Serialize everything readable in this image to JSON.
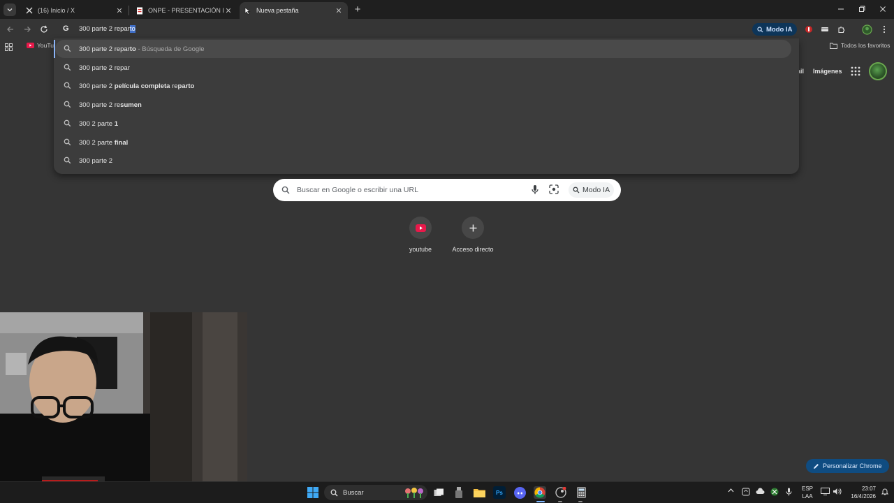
{
  "tabs": [
    {
      "title": "(16) Inicio / X",
      "favicon": "x-logo-icon"
    },
    {
      "title": "ONPE - PRESENTACIÓN DE RESULTADOS",
      "favicon": "onpe-doc-icon"
    },
    {
      "title": "Nueva pestaña",
      "favicon": "chrome-tab-icon",
      "active": true
    }
  ],
  "omnibox": {
    "typed": "300 parte 2 repar",
    "autocompleted": "to"
  },
  "toolbar": {
    "modo_ia": "Modo IA"
  },
  "bookmarks": {
    "youtube": "YouTube",
    "all": "Todos los favoritos"
  },
  "suggestions": [
    {
      "parts": [
        {
          "t": "300 parte 2 repar",
          "b": false
        },
        {
          "t": "to",
          "b": true
        }
      ],
      "suffix": " - Búsqueda de Google"
    },
    {
      "parts": [
        {
          "t": "300 parte 2 repar",
          "b": false
        }
      ],
      "suffix": ""
    },
    {
      "parts": [
        {
          "t": "300 parte 2 ",
          "b": false
        },
        {
          "t": "película completa",
          "b": true
        },
        {
          "t": " re",
          "b": false
        },
        {
          "t": "parto",
          "b": true
        }
      ],
      "suffix": ""
    },
    {
      "parts": [
        {
          "t": "300 parte 2 re",
          "b": false
        },
        {
          "t": "sumen",
          "b": true
        }
      ],
      "suffix": ""
    },
    {
      "parts": [
        {
          "t": "300 2 parte ",
          "b": false
        },
        {
          "t": "1",
          "b": true
        }
      ],
      "suffix": ""
    },
    {
      "parts": [
        {
          "t": "300 2 parte ",
          "b": false
        },
        {
          "t": "final",
          "b": true
        }
      ],
      "suffix": ""
    },
    {
      "parts": [
        {
          "t": "300 parte 2",
          "b": false
        }
      ],
      "suffix": ""
    }
  ],
  "ntp": {
    "gmail": "ail",
    "imagenes": "Imágenes",
    "search_placeholder": "Buscar en Google o escribir una URL",
    "modo_ia": "Modo IA",
    "shortcuts": [
      {
        "label": "youtube"
      },
      {
        "label": "Acceso directo"
      }
    ],
    "customize": "Personalizar Chrome"
  },
  "taskbar": {
    "search": "Buscar",
    "lang_top": "ESP",
    "lang_bottom": "LAA",
    "time": "23:07",
    "date": "16/4/2026"
  },
  "colors": {
    "accent": "#0d3559",
    "youtube_red": "#e8194a",
    "selection": "#3f6fc9"
  }
}
